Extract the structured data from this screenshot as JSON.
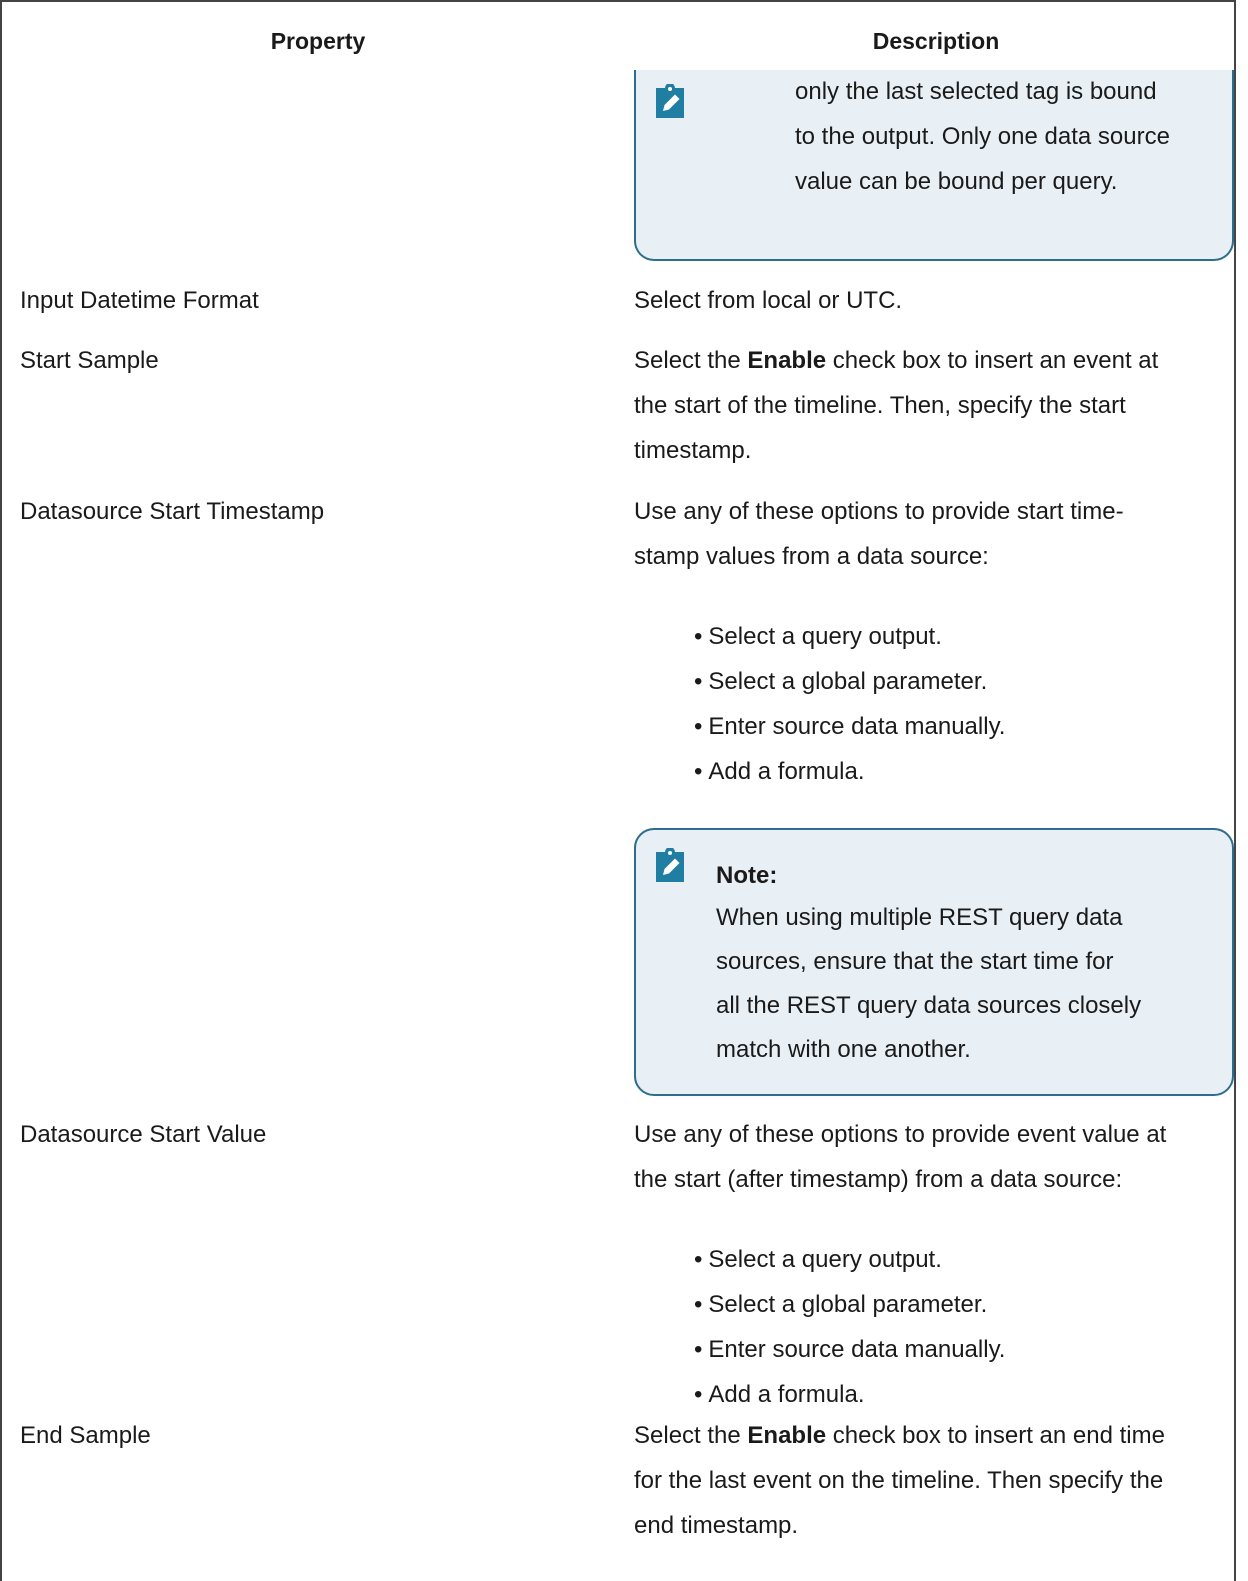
{
  "header": {
    "property": "Property",
    "description": "Description"
  },
  "top_note": {
    "lines": [
      "only the last selected tag is bound",
      "to the output. Only one data source",
      "value can be bound per query."
    ]
  },
  "rows": {
    "input_datetime": {
      "property": "Input Datetime Format",
      "description": "Select from local or UTC."
    },
    "start_sample": {
      "property": "Start Sample",
      "line1_pre": "Select the ",
      "line1_bold": "Enable",
      "line1_post": " check box to insert an event at",
      "line2": "the start of the timeline. Then, specify the start",
      "line3": "timestamp."
    },
    "ds_start_timestamp": {
      "property": "Datasource Start Timestamp",
      "line1": "Use any of these options to provide start time-",
      "line2": "stamp values from a data source:",
      "bullets": [
        "Select a query output.",
        "Select a global parameter.",
        "Enter source data manually.",
        "Add a formula."
      ],
      "note": {
        "title": "Note:",
        "lines": [
          "When using multiple REST query data",
          "sources, ensure that the start time for",
          "all the REST query data sources closely",
          "match with one another."
        ]
      }
    },
    "ds_start_value": {
      "property": "Datasource Start Value",
      "line1": "Use any of these options to provide event value at",
      "line2": "the start (after timestamp) from a data source:",
      "bullets": [
        "Select a query output.",
        "Select a global parameter.",
        "Enter source data manually.",
        "Add a formula."
      ]
    },
    "end_sample": {
      "property": "End Sample",
      "line1_pre": "Select the ",
      "line1_bold": "Enable",
      "line1_post": " check box to insert an end time",
      "line2": "for the last event on the timeline. Then specify the",
      "line3": "end timestamp."
    }
  },
  "icons": {
    "note": "note-pencil-icon"
  },
  "colors": {
    "note_border": "#2e6d8c",
    "note_bg": "#e8f0f6",
    "icon": "#1f7ea1"
  }
}
